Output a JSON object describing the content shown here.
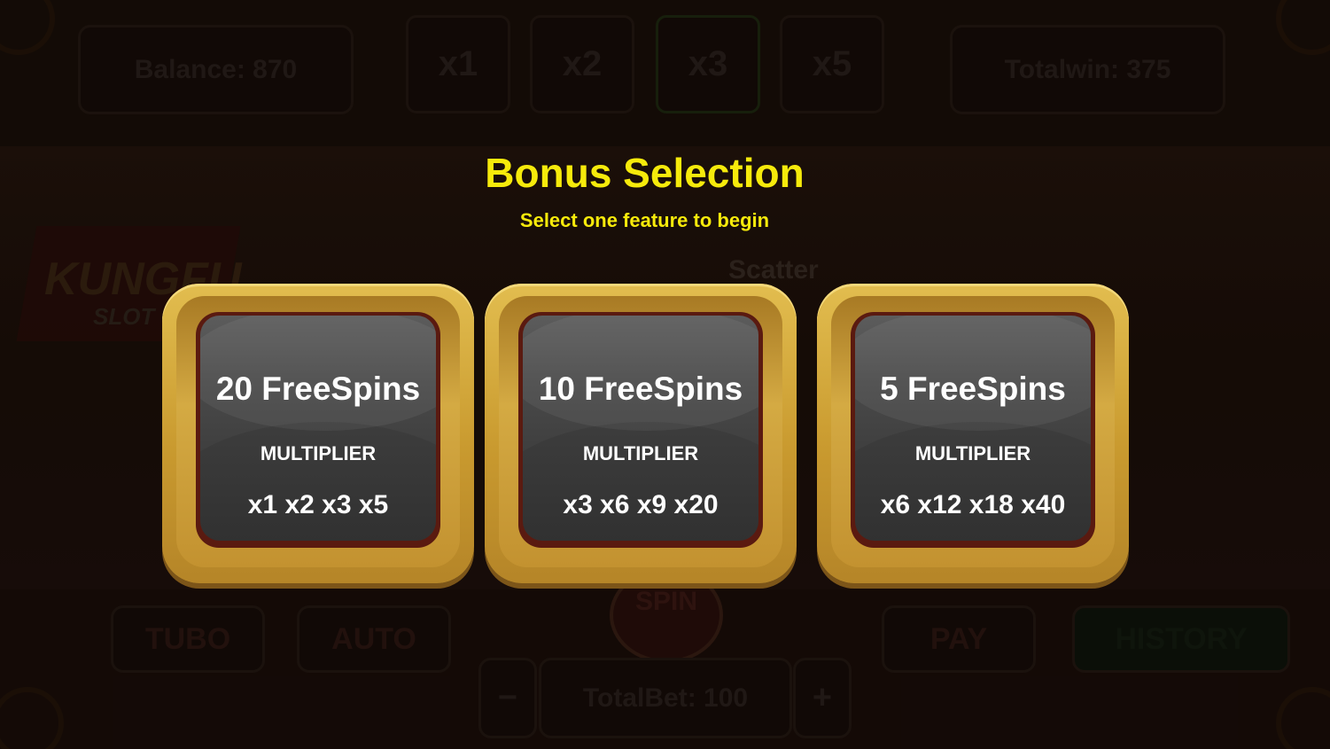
{
  "background": {
    "balance_label": "Balance: 870",
    "multiplier_buttons": [
      "x1",
      "x2",
      "x3",
      "x5"
    ],
    "totalwin_label": "Totalwin: 375",
    "logo_text": "KUNGFU",
    "logo_subtext": "SLOT",
    "scatter_label": "Scatter",
    "turbo_label": "TUBO",
    "auto_label": "AUTO",
    "spin_label": "SPIN",
    "pay_label": "PAY",
    "history_label": "HISTORY",
    "minus_label": "−",
    "plus_label": "+",
    "totalbet_label": "TotalBet: 100"
  },
  "modal": {
    "title": "Bonus Selection",
    "subtitle": "Select one feature to begin",
    "options": [
      {
        "spins": "20 FreeSpins",
        "multiplier_label": "MULTIPLIER",
        "multipliers": "x1 x2 x3 x5"
      },
      {
        "spins": "10 FreeSpins",
        "multiplier_label": "MULTIPLIER",
        "multipliers": "x3 x6 x9 x20"
      },
      {
        "spins": "5 FreeSpins",
        "multiplier_label": "MULTIPLIER",
        "multipliers": "x6 x12 x18 x40"
      }
    ]
  },
  "colors": {
    "title_yellow": "#f6ea0b",
    "card_gold": "#d4aa43",
    "card_face": "#4a4a4a"
  }
}
